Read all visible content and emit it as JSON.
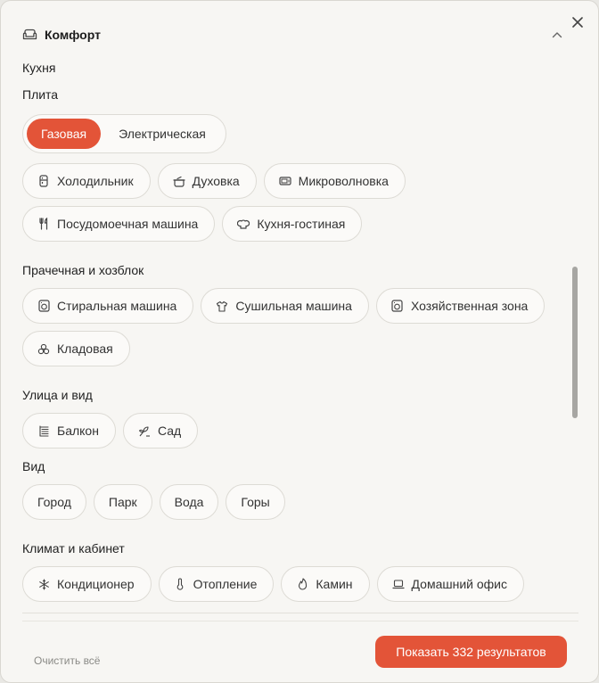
{
  "header": {
    "title": "Комфорт",
    "icon": "sofa-icon"
  },
  "kitchen": {
    "title": "Кухня",
    "stove": {
      "title": "Плита",
      "options": [
        "Газовая",
        "Электрическая"
      ],
      "selected": "Газовая"
    },
    "chips": [
      "Холодильник",
      "Духовка",
      "Микроволновка",
      "Посудомоечная машина",
      "Кухня-гостиная"
    ]
  },
  "laundry": {
    "title": "Прачечная и хозблок",
    "chips": [
      "Стиральная машина",
      "Сушильная машина",
      "Хозяйственная зона",
      "Кладовая"
    ]
  },
  "outdoor": {
    "title": "Улица и вид",
    "chips": [
      "Балкон",
      "Сад"
    ]
  },
  "view": {
    "title": "Вид",
    "chips": [
      "Город",
      "Парк",
      "Вода",
      "Горы"
    ]
  },
  "climate": {
    "title": "Климат и кабинет",
    "chips": [
      "Кондиционер",
      "Отопление",
      "Камин",
      "Домашний офис"
    ]
  },
  "footer": {
    "clear_label": "Очистить всё",
    "show_label": "Показать 332 результатов"
  },
  "colors": {
    "accent": "#e35438",
    "background": "#f7f6f3",
    "chip_border": "#dddbd5"
  }
}
